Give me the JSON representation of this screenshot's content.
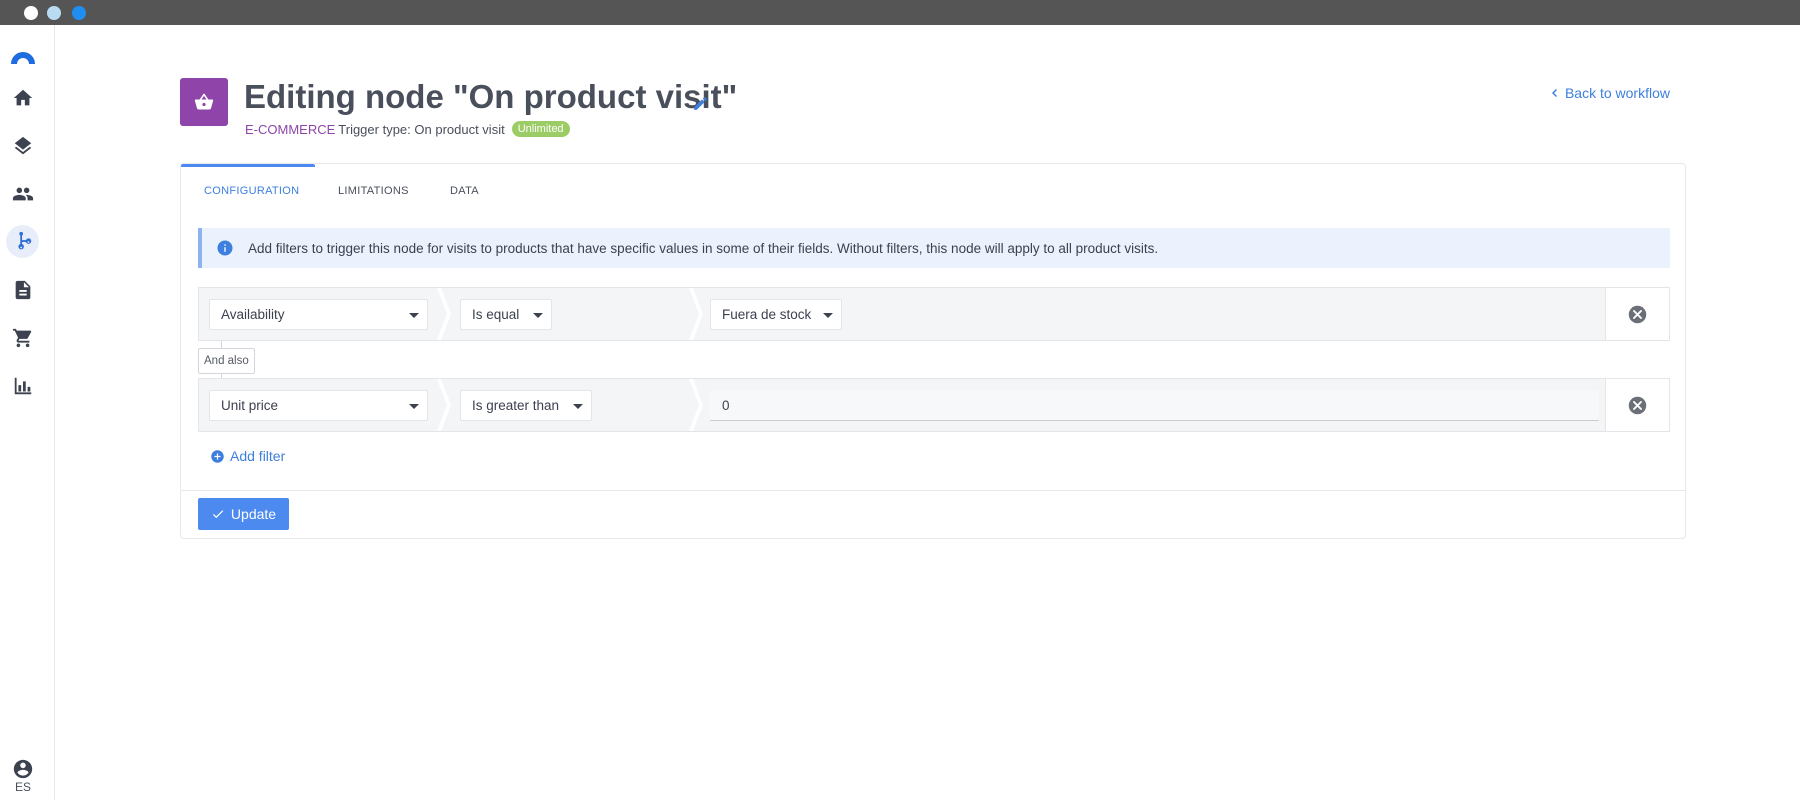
{
  "sidebar": {
    "language": "ES",
    "icons": [
      "logo-icon",
      "home-icon",
      "layers-icon",
      "users-icon",
      "workflow-icon",
      "document-icon",
      "cart-icon",
      "chart-icon",
      "profile-icon"
    ],
    "active": "workflow-icon"
  },
  "header": {
    "title": "Editing node \"On product visit\"",
    "category": "E-COMMERCE",
    "trigger_type": "Trigger type: On product visit",
    "badge": "Unlimited",
    "back_link": "Back to workflow"
  },
  "tabs": [
    {
      "label": "CONFIGURATION",
      "active": true
    },
    {
      "label": "LIMITATIONS",
      "active": false
    },
    {
      "label": "DATA",
      "active": false
    }
  ],
  "info": {
    "text": "Add filters to trigger this node for visits to products that have specific values in some of their fields. Without filters, this node will apply to all product visits."
  },
  "filters": [
    {
      "field": "Availability",
      "operator": "Is equal",
      "value": "Fuera de stock",
      "value_type": "select"
    },
    {
      "field": "Unit price",
      "operator": "Is greater than",
      "value": "0",
      "value_type": "input"
    }
  ],
  "connector_label": "And also",
  "add_filter_label": "Add filter",
  "update_label": "Update",
  "colors": {
    "accent": "#4c8af0",
    "category": "#8e44a8",
    "badge": "#9ccc65",
    "info_bg": "#ebf2fd"
  }
}
